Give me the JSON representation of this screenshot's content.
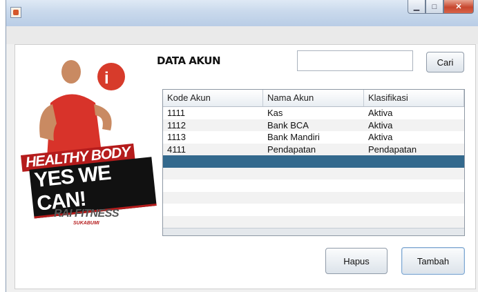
{
  "window": {
    "title": ""
  },
  "titlebar": {
    "minimize_glyph": "▁",
    "maximize_glyph": "□",
    "close_glyph": "✕"
  },
  "logo": {
    "banner_line1": "HEALTHY BODY",
    "banner_line2": "YES WE CAN!",
    "brand": "RAI FITNESS",
    "brand_sub": "SUKABUMI"
  },
  "page": {
    "title": "DATA AKUN"
  },
  "search": {
    "value": "",
    "placeholder": "",
    "button_label": "Cari"
  },
  "table": {
    "headers": [
      "Kode Akun",
      "Nama Akun",
      "Klasifikasi"
    ],
    "rows": [
      [
        "1111",
        "Kas",
        "Aktiva"
      ],
      [
        "1112",
        "Bank BCA",
        "Aktiva"
      ],
      [
        "1113",
        "Bank Mandiri",
        "Aktiva"
      ],
      [
        "4111",
        "Pendapatan",
        "Pendapatan"
      ],
      [
        "",
        "",
        ""
      ],
      [
        "",
        "",
        ""
      ],
      [
        "",
        "",
        ""
      ],
      [
        "",
        "",
        ""
      ],
      [
        "",
        "",
        ""
      ],
      [
        "",
        "",
        ""
      ]
    ],
    "selected_row_index": 4
  },
  "actions": {
    "delete_label": "Hapus",
    "add_label": "Tambah"
  },
  "colors": {
    "selection": "#33698d",
    "brand_red": "#b51c1c"
  }
}
